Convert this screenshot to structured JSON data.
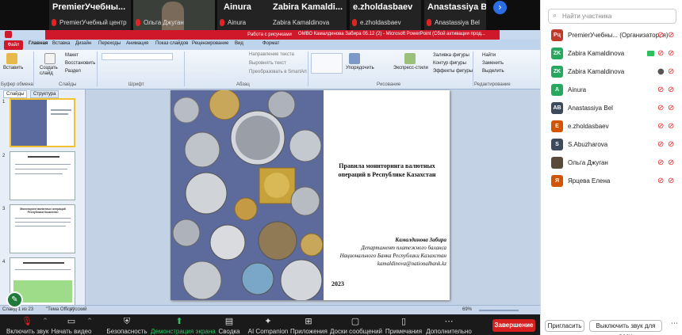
{
  "gallery": {
    "tiles": [
      {
        "name": "PremierУчебны...",
        "sub": "PremierУчебный центр"
      },
      {
        "name": "",
        "sub": "Ольга Джуган"
      },
      {
        "name": "Ainura",
        "sub": "Ainura"
      },
      {
        "name": "Zabira Kamaldi...",
        "sub": "Zabira Kamaldinova"
      },
      {
        "name": "e.zholdasbaev",
        "sub": "e.zholdasbaev"
      },
      {
        "name": "Anastassiya Bel",
        "sub": "Anastassiya Bel"
      }
    ],
    "next_icon": "chevron-right-icon"
  },
  "ppt": {
    "window_title": "ОМВО Камалдинова Забира 05.12 (2) - Microsoft PowerPoint (Сбой активации прод...",
    "context_tab": "Работа с рисунками",
    "file_tab": "Файл",
    "tabs": [
      "Главная",
      "Вставка",
      "Дизайн",
      "Переходы",
      "Анимация",
      "Показ слайдов",
      "Рецензирование",
      "Вид",
      "Формат"
    ],
    "ribbon": {
      "paste": "Вставить",
      "clipboard_group": "Буфер обмена",
      "new_slide": "Создать слайд",
      "layout": "Макет",
      "reset": "Восстановить",
      "section": "Раздел",
      "slides_group": "Слайды",
      "font_group": "Шрифт",
      "text_direction": "Направление текста",
      "align_text": "Выровнять текст",
      "smartart": "Преобразовать в SmartArt",
      "paragraph_group": "Абзац",
      "arrange": "Упорядочить",
      "quick_styles": "Экспресс-стили",
      "shape_fill": "Заливка фигуры",
      "shape_outline": "Контур фигуры",
      "shape_effects": "Эффекты фигуры",
      "drawing_group": "Рисование",
      "find": "Найти",
      "replace": "Заменить",
      "select": "Выделить",
      "editing_group": "Редактирование"
    },
    "panel_tabs": [
      "Слайды",
      "Структура"
    ],
    "thumb_numbers": [
      "1",
      "2",
      "3",
      "4"
    ],
    "thumb3_title": "Мониторинг валютных операций Республики Казахстан",
    "slide": {
      "title": "Правила мониторинга валютных операций в Республике Казахстан",
      "author_name": "Камалдинова Забира",
      "author_line1": "Департамент платежного баланса",
      "author_line2": "Национального Банка Республики Казахстан",
      "author_email": "kamaldinova@nationalbank.kz",
      "year": "2023"
    },
    "status": {
      "slide_info": "Слайд 1 из 23",
      "theme": "\"Тема Office\"",
      "lang": "русский",
      "zoom": "69%"
    }
  },
  "toolbar": {
    "items": [
      {
        "label": "Включить звук",
        "icon": "mic-off-icon"
      },
      {
        "label": "Начать видео",
        "icon": "video-off-icon"
      },
      {
        "label": "Безопасность",
        "icon": "shield-icon"
      },
      {
        "label": "Демонстрация экрана",
        "icon": "share-screen-icon"
      },
      {
        "label": "Сводка",
        "icon": "summary-icon"
      },
      {
        "label": "AI Companion",
        "icon": "ai-companion-icon"
      },
      {
        "label": "Приложения",
        "icon": "apps-icon"
      },
      {
        "label": "Доски сообщений",
        "icon": "whiteboards-icon"
      },
      {
        "label": "Примечания",
        "icon": "notes-icon"
      },
      {
        "label": "Дополнительно",
        "icon": "more-icon"
      }
    ],
    "end_label": "Завершение"
  },
  "participants": {
    "search_placeholder": "Найти участника",
    "list": [
      {
        "initials": "Рц",
        "name": "PremierУчебны...  (Организатор, я)",
        "color": "#c0392b",
        "mic": "muted",
        "cam": "off"
      },
      {
        "initials": "ZK",
        "name": "Zabira Kamaldinova",
        "color": "#27a85f",
        "mic": "muted",
        "cam": "on"
      },
      {
        "initials": "ZK",
        "name": "Zabira Kamaldinova",
        "color": "#27a85f",
        "mic": "unmuted",
        "cam": "off"
      },
      {
        "initials": "A",
        "name": "Ainura",
        "color": "#27a85f",
        "mic": "muted",
        "cam": "off"
      },
      {
        "initials": "AB",
        "name": "Anastassiya Bel",
        "color": "#3d4a5c",
        "mic": "muted",
        "cam": "off"
      },
      {
        "initials": "E",
        "name": "e.zholdasbaev",
        "color": "#d35400",
        "mic": "muted",
        "cam": "off"
      },
      {
        "initials": "S",
        "name": "S.Abuzharova",
        "color": "#3d4a5c",
        "mic": "muted",
        "cam": "off"
      },
      {
        "initials": "",
        "name": "Ольга Джуган",
        "color": "#222222",
        "mic": "muted",
        "cam": "off"
      },
      {
        "initials": "Я",
        "name": "Ярцева Елена",
        "color": "#d35400",
        "mic": "muted",
        "cam": "off"
      }
    ],
    "invite": "Пригласить",
    "unmute_all": "Выключить звук для всех"
  }
}
